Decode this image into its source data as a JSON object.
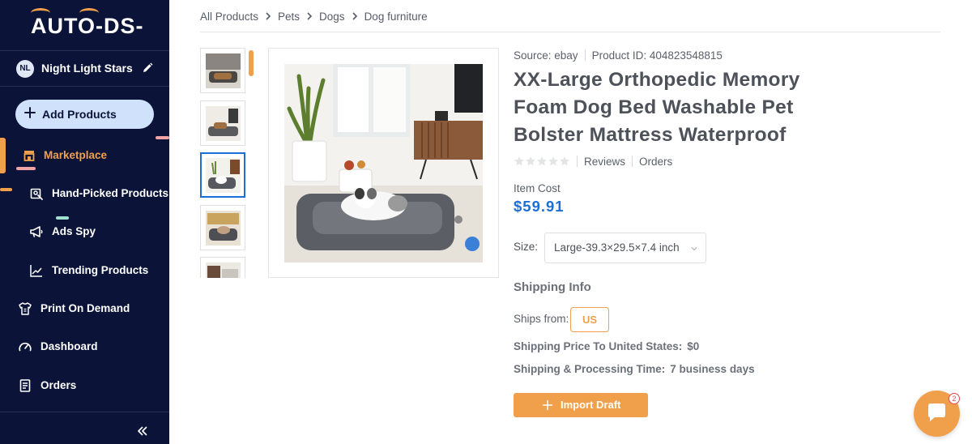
{
  "brand": {
    "logo_text": "AUTO-DS-"
  },
  "user": {
    "initials": "NL",
    "name": "Night Light Stars"
  },
  "sidebar": {
    "add_products": "Add Products",
    "items": [
      {
        "label": "Marketplace",
        "icon": "store-icon",
        "active": true
      },
      {
        "label": "Hand-Picked Products",
        "icon": "hand-picked-icon"
      },
      {
        "label": "Ads Spy",
        "icon": "megaphone-icon"
      },
      {
        "label": "Trending Products",
        "icon": "trending-chart-icon"
      },
      {
        "label": "Print On Demand",
        "icon": "tshirt-icon"
      },
      {
        "label": "Dashboard",
        "icon": "gauge-icon"
      },
      {
        "label": "Orders",
        "icon": "receipt-icon"
      }
    ]
  },
  "breadcrumb": [
    "All Products",
    "Pets",
    "Dogs",
    "Dog furniture"
  ],
  "product": {
    "source": "Source: ebay",
    "product_id": "Product ID: 404823548815",
    "title": "XX-Large Orthopedic Memory Foam Dog Bed Washable Pet Bolster Mattress Waterproof",
    "rating": 0,
    "reviews_label": "Reviews",
    "orders_label": "Orders",
    "item_cost_label": "Item Cost",
    "item_cost": "$59.91",
    "size_label": "Size:",
    "size_value": "Large-39.3×29.5×7.4 inch",
    "thumbnail_count": 5,
    "selected_thumbnail": 3
  },
  "shipping": {
    "heading": "Shipping Info",
    "ships_from_label": "Ships from:",
    "ships_from": "US",
    "price_label": "Shipping Price To United States:",
    "price_value": "$0",
    "time_label": "Shipping & Processing Time:",
    "time_value": "7 business days"
  },
  "actions": {
    "import_draft": "Import Draft"
  },
  "chat": {
    "badge_count": "2"
  },
  "colors": {
    "sidebar_bg": "#0b1438",
    "accent": "#f0a04b",
    "link_blue": "#1c6fd8",
    "add_btn_bg": "#d0e1fb"
  }
}
